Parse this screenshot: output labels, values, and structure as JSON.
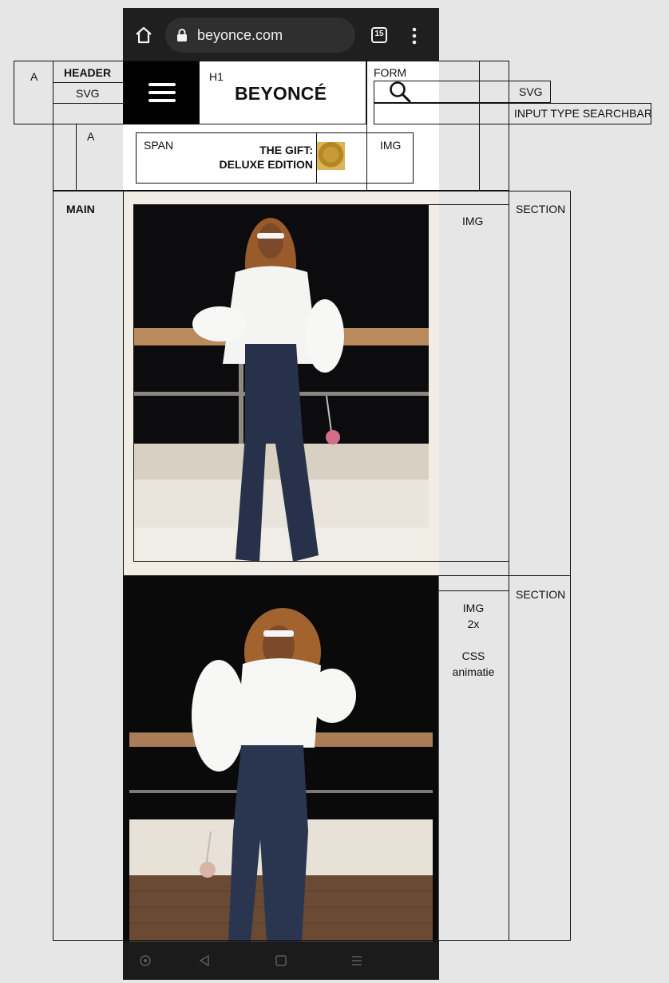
{
  "browser": {
    "url": "beyonce.com",
    "tab_count": "15"
  },
  "site": {
    "logo": "BEYONCÉ",
    "promo_title_line1": "THE GIFT:",
    "promo_title_line2": "DELUXE EDITION"
  },
  "annotations": {
    "a_header_link": "A",
    "header": "HEADER",
    "svg_left": "SVG",
    "h1": "H1",
    "form": "FORM",
    "svg_right": "SVG",
    "input": "INPUT TYPE SEARCHBAR",
    "a_promo_link": "A",
    "span": "SPAN",
    "img_promo": "IMG",
    "main": "MAIN",
    "img1": "IMG",
    "section1": "SECTION",
    "img2_line1": "IMG",
    "img2_line2": "2x",
    "img2_line3": "CSS",
    "img2_line4": "animatie",
    "section2": "SECTION"
  },
  "icons": {
    "home": "home-icon",
    "lock": "lock-icon",
    "tabs": "tabs-counter-icon",
    "overflow": "more-vertical-icon",
    "menu": "hamburger-menu-icon",
    "search": "search-icon",
    "nav_circle": "nav-circle-icon",
    "nav_back": "nav-back-icon",
    "nav_home": "nav-home-square-icon",
    "nav_menu": "nav-menu-icon"
  },
  "colors": {
    "page_bg": "#e6e6e6",
    "browser_bar": "#1f1f1f",
    "photo_bg": "#0e0e10",
    "section_bg": "#f1ede5"
  }
}
